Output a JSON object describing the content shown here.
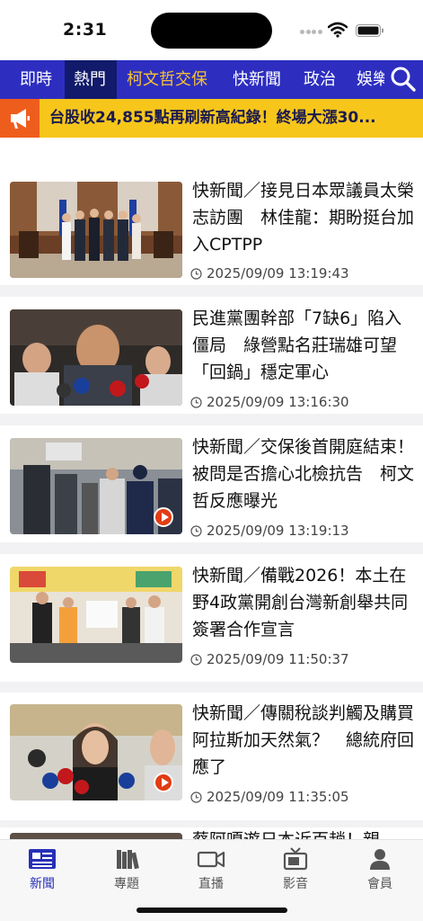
{
  "status": {
    "time": "2:31"
  },
  "nav": {
    "tabs": [
      {
        "label": "即時"
      },
      {
        "label": "熱門"
      },
      {
        "label": "柯文哲交保"
      },
      {
        "label": "快新聞"
      },
      {
        "label": "政治"
      },
      {
        "label": "娛樂"
      }
    ],
    "active_index": 1,
    "highlight_index": 2
  },
  "ticker": {
    "text": "台股收24,855點再刷新高紀錄！終場大漲30..."
  },
  "articles": [
    {
      "headline": "快新聞／接見日本眾議員太榮志訪團　林佳龍：期盼挺台加入CPTPP",
      "time": "2025/09/09 13:19:43",
      "video": false
    },
    {
      "headline": "民進黨團幹部「7缺6」陷入僵局　綠營點名莊瑞雄可望「回鍋」穩定軍心",
      "time": "2025/09/09 13:16:30",
      "video": false
    },
    {
      "headline": "快新聞／交保後首開庭結束！被問是否擔心北檢抗告　柯文哲反應曝光",
      "time": "2025/09/09 13:19:13",
      "video": true
    },
    {
      "headline": "快新聞／備戰2026！本土在野4政黨開創台灣新創舉共同簽署合作宣言",
      "time": "2025/09/09 11:50:37",
      "video": false
    },
    {
      "headline": "快新聞／傳關稅談判觸及購買阿拉斯加天然氣？　總統府回應了",
      "time": "2025/09/09 11:35:05",
      "video": true
    },
    {
      "headline": "蔡阿嘎遊日本近百趟！親",
      "time": "",
      "video": false
    }
  ],
  "tabbar": {
    "items": [
      {
        "label": "新聞",
        "icon": "news-icon"
      },
      {
        "label": "專題",
        "icon": "books-icon"
      },
      {
        "label": "直播",
        "icon": "video-camera-icon"
      },
      {
        "label": "影音",
        "icon": "tv-icon"
      },
      {
        "label": "會員",
        "icon": "person-icon"
      }
    ],
    "active_index": 0
  },
  "colors": {
    "nav_bg": "#2d2ec0",
    "nav_active": "#111a6b",
    "highlight": "#f6c234",
    "ticker_bg": "#f7c61b",
    "ticker_icon_bg": "#ef5d1d",
    "tab_active": "#2730b6"
  }
}
